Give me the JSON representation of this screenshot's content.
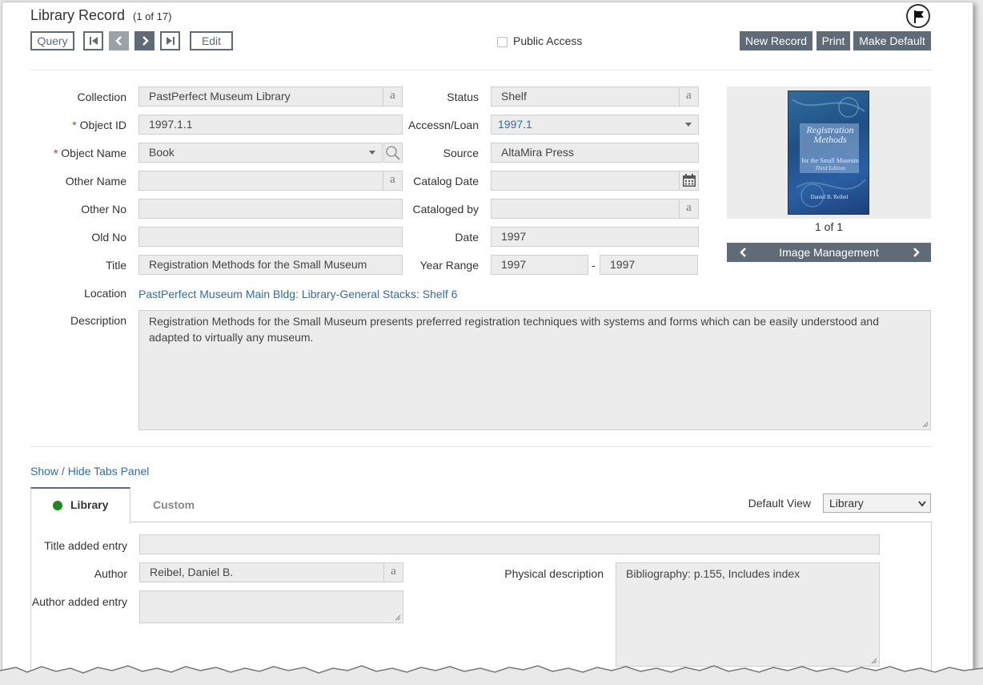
{
  "header": {
    "title": "Library Record",
    "record_count": "(1 of 17)"
  },
  "toolbar": {
    "query_label": "Query",
    "edit_label": "Edit",
    "public_access_label": "Public Access",
    "new_record_label": "New Record",
    "print_label": "Print",
    "make_default_label": "Make Default"
  },
  "fields": {
    "collection": {
      "label": "Collection",
      "value": "PastPerfect Museum Library",
      "badge": "a"
    },
    "object_id": {
      "label": "Object ID",
      "value": "1997.1.1",
      "required": "*"
    },
    "object_name": {
      "label": "Object Name",
      "value": "Book",
      "required": "*"
    },
    "other_name": {
      "label": "Other Name",
      "value": "",
      "badge": "a"
    },
    "other_no": {
      "label": "Other No",
      "value": ""
    },
    "old_no": {
      "label": "Old No",
      "value": ""
    },
    "title": {
      "label": "Title",
      "value": "Registration Methods for the Small Museum"
    },
    "status": {
      "label": "Status",
      "value": "Shelf",
      "badge": "a"
    },
    "accessn_loan": {
      "label": "Accessn/Loan",
      "value": "1997.1"
    },
    "source": {
      "label": "Source",
      "value": "AltaMira Press"
    },
    "catalog_date": {
      "label": "Catalog Date",
      "value": ""
    },
    "cataloged_by": {
      "label": "Cataloged by",
      "value": "",
      "badge": "a"
    },
    "date": {
      "label": "Date",
      "value": "1997"
    },
    "year_range": {
      "label": "Year Range",
      "from": "1997",
      "separator": "-",
      "to": "1997"
    },
    "location": {
      "label": "Location",
      "value": "PastPerfect Museum Main Bldg: Library-General Stacks: Shelf 6"
    },
    "description": {
      "label": "Description",
      "value": "Registration Methods for the Small Museum presents preferred registration techniques with systems and forms which can be easily understood and adapted to virtually any museum."
    }
  },
  "image": {
    "counter": "1 of 1",
    "management_label": "Image Management",
    "cover_title": "Registration Methods",
    "cover_subtitle": "for the Small Museum",
    "cover_edition": "Third Edition",
    "cover_author": "Daniel B. Reibel"
  },
  "tabs": {
    "toggle_label": "Show / Hide Tabs Panel",
    "items": [
      {
        "label": "Library",
        "active": true,
        "indicator_color": "#1e8a1e"
      },
      {
        "label": "Custom",
        "active": false
      }
    ],
    "default_view_label": "Default View",
    "default_view_value": "Library"
  },
  "library_tab": {
    "title_added_entry": {
      "label": "Title added entry",
      "value": ""
    },
    "author": {
      "label": "Author",
      "value": "Reibel, Daniel B.",
      "badge": "a"
    },
    "author_added_entry": {
      "label": "Author added entry",
      "value": ""
    },
    "physical_description": {
      "label": "Physical description",
      "value": "Bibliography: p.155, Includes index"
    }
  },
  "colors": {
    "button_dark": "#5f6b76",
    "link": "#2f6ea5",
    "required": "#c0392b",
    "field_bg": "#ececec"
  }
}
